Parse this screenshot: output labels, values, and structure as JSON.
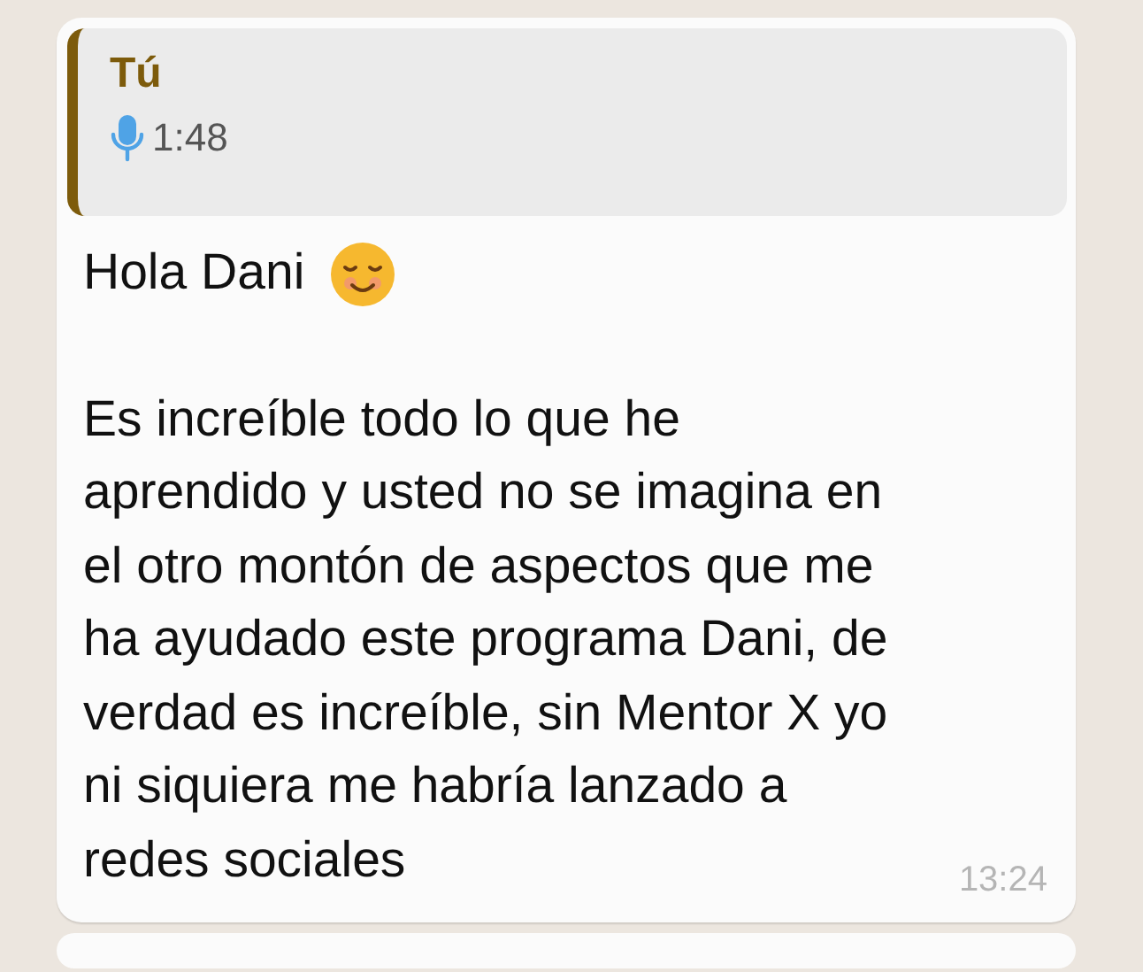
{
  "message": {
    "quote": {
      "author": "Tú",
      "kind": "voice",
      "duration": "1:48"
    },
    "greeting": "Hola Dani",
    "lines": [
      "Es increíble todo lo que he",
      "aprendido y usted no se imagina en",
      "el otro montón de aspectos que me",
      "ha ayudado este programa Dani, de",
      "verdad es increíble, sin Mentor X yo",
      "ni siquiera me habría lanzado a",
      "redes sociales"
    ],
    "time": "13:24"
  }
}
